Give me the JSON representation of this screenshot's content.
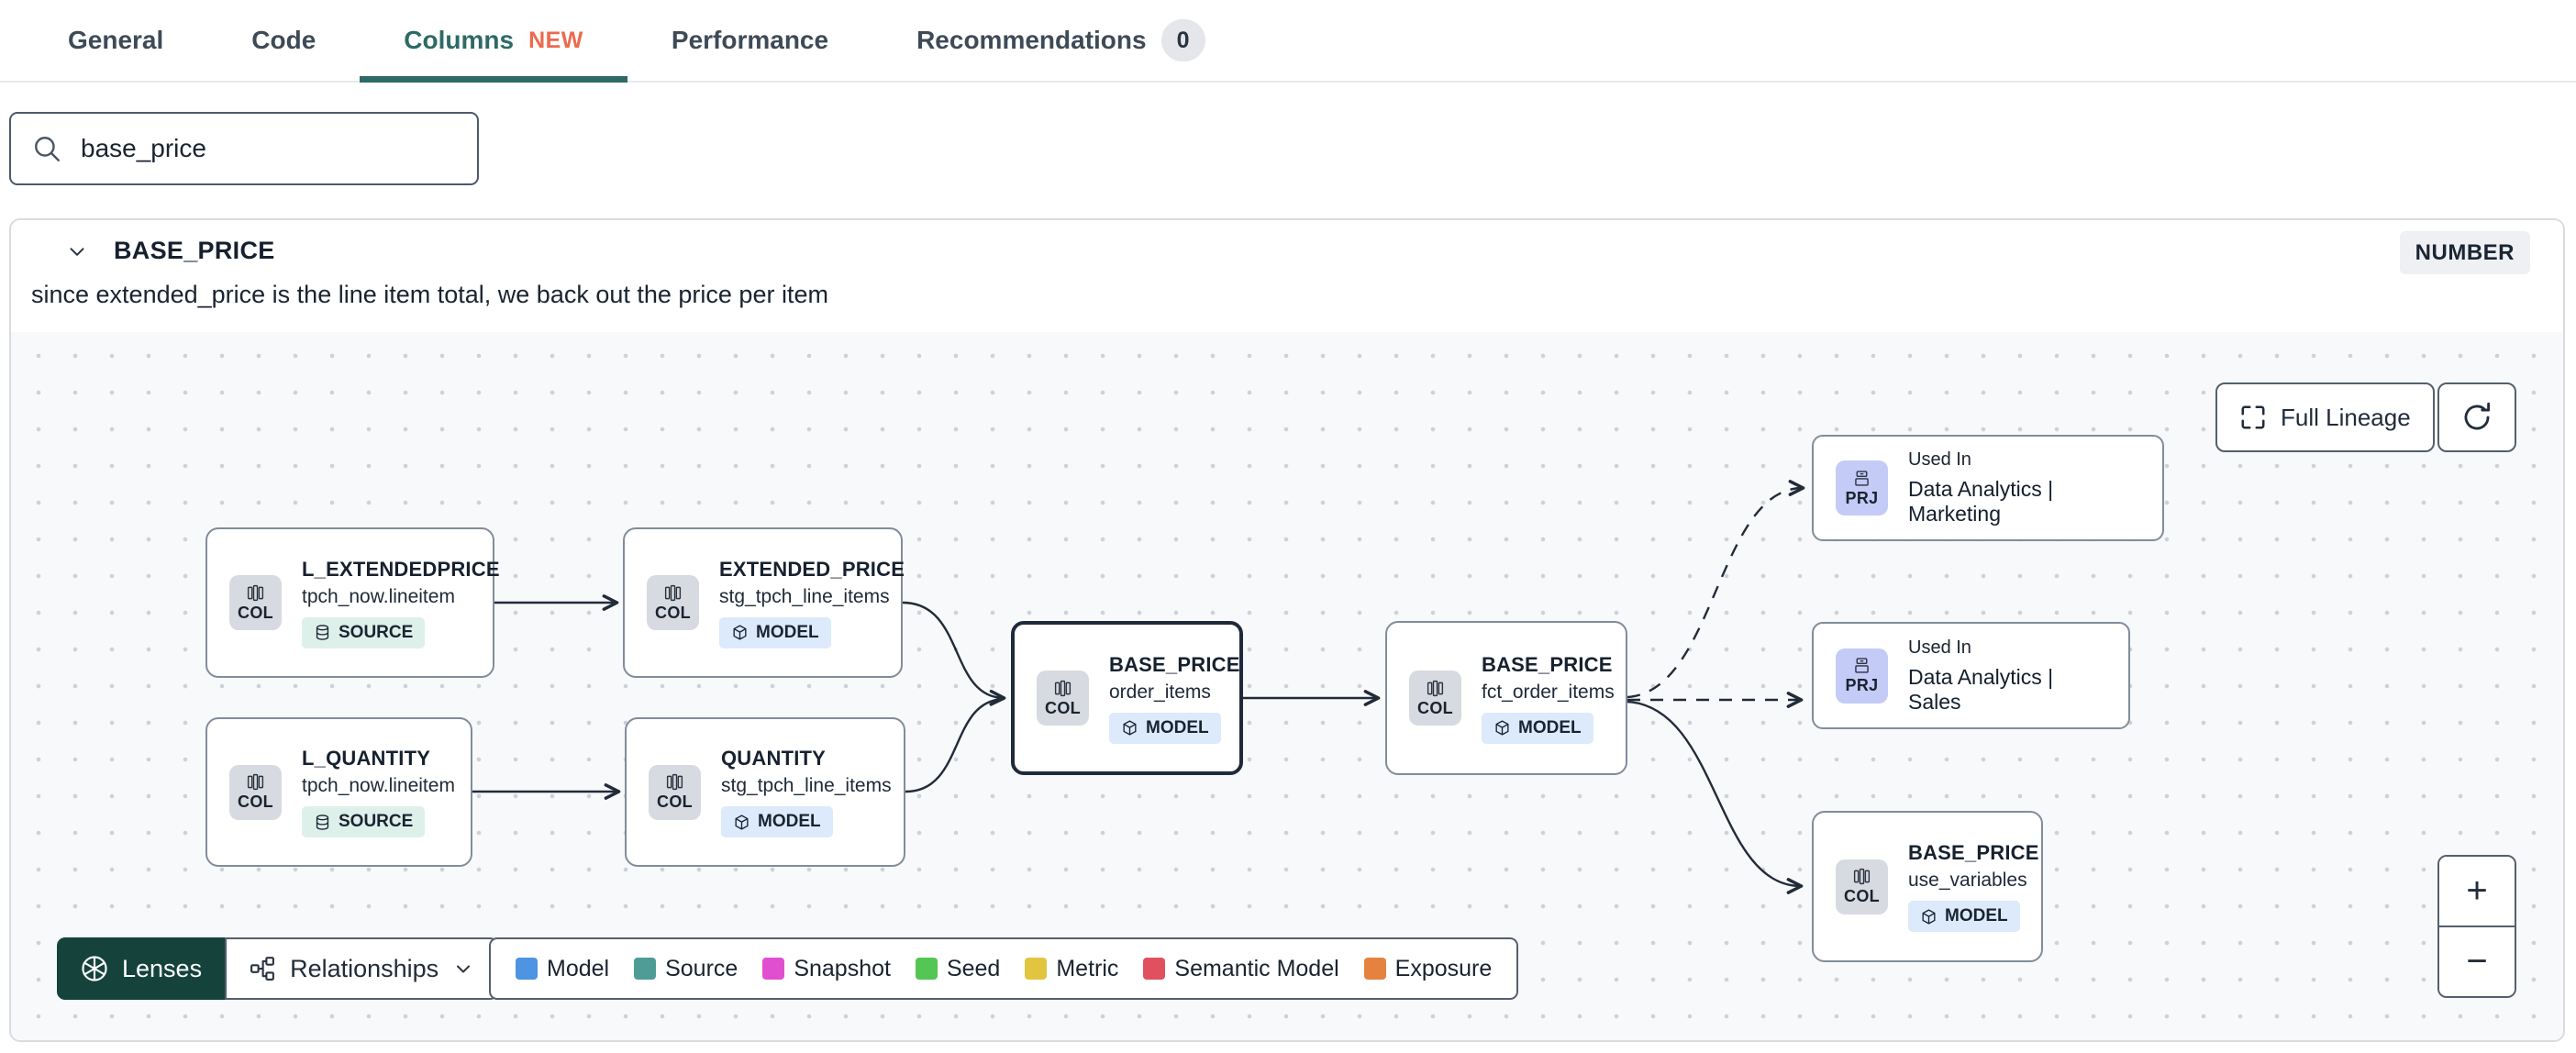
{
  "tabs": {
    "general": "General",
    "code": "Code",
    "columns": "Columns",
    "columns_badge": "NEW",
    "performance": "Performance",
    "recommendations": "Recommendations",
    "recommendations_count": "0"
  },
  "search": {
    "value": "base_price"
  },
  "column_panel": {
    "name": "BASE_PRICE",
    "type_badge": "NUMBER",
    "description": "since extended_price is the line item total, we back out the price per item"
  },
  "lineage": {
    "full_lineage_label": "Full Lineage",
    "lenses_label": "Lenses",
    "relationships_label": "Relationships",
    "zoom_in": "+",
    "zoom_out": "−",
    "nodes": [
      {
        "chip": "COL",
        "title": "L_EXTENDEDPRICE",
        "subtitle": "tpch_now.lineitem",
        "badge": "SOURCE"
      },
      {
        "chip": "COL",
        "title": "EXTENDED_PRICE",
        "subtitle": "stg_tpch_line_items",
        "badge": "MODEL"
      },
      {
        "chip": "COL",
        "title": "L_QUANTITY",
        "subtitle": "tpch_now.lineitem",
        "badge": "SOURCE"
      },
      {
        "chip": "COL",
        "title": "QUANTITY",
        "subtitle": "stg_tpch_line_items",
        "badge": "MODEL"
      },
      {
        "chip": "COL",
        "title": "BASE_PRICE",
        "subtitle": "order_items",
        "badge": "MODEL",
        "selected": true
      },
      {
        "chip": "COL",
        "title": "BASE_PRICE",
        "subtitle": "fct_order_items",
        "badge": "MODEL"
      },
      {
        "chip": "PRJ",
        "eyebrow": "Used In",
        "title": "Data Analytics | Marketing"
      },
      {
        "chip": "PRJ",
        "eyebrow": "Used In",
        "title": "Data Analytics | Sales"
      },
      {
        "chip": "COL",
        "title": "BASE_PRICE",
        "subtitle": "use_variables",
        "badge": "MODEL"
      }
    ],
    "legend": [
      {
        "label": "Model",
        "color": "#4d94e2"
      },
      {
        "label": "Source",
        "color": "#4f9c97"
      },
      {
        "label": "Snapshot",
        "color": "#e14fd1"
      },
      {
        "label": "Seed",
        "color": "#53c653"
      },
      {
        "label": "Metric",
        "color": "#e2c53e"
      },
      {
        "label": "Semantic Model",
        "color": "#e1505f"
      },
      {
        "label": "Exposure",
        "color": "#e5823f"
      }
    ]
  }
}
